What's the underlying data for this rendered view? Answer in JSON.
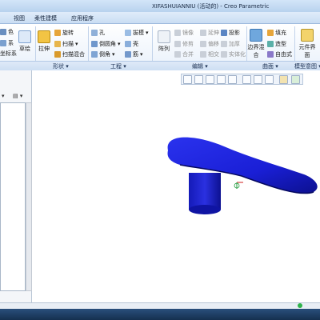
{
  "window": {
    "title": "XIFASHUIANNIU (活动的) - Creo Parametric"
  },
  "menu": {
    "tabs": [
      "视图",
      "柔性建模",
      "应用程序"
    ]
  },
  "ribbon": {
    "left_items": [
      "色",
      "系",
      "坐标系"
    ],
    "sketch_label": "草绘",
    "extrude_label": "拉伸",
    "shape": {
      "revolve": "旋转",
      "sweep": "扫描",
      "blend": "扫描混合"
    },
    "engineering": {
      "hole": "孔",
      "round": "倒圆角",
      "chamfer": "倒角",
      "draft": "拔模",
      "shell": "壳",
      "rib": "筋"
    },
    "pattern_label": "阵列",
    "editing": {
      "mirror": "镜像",
      "extend": "延伸",
      "project": "投影",
      "trim": "修剪",
      "offset": "偏移",
      "thicken": "加厚",
      "merge": "合并",
      "intersect": "相交",
      "solidify": "实体化"
    },
    "surface": {
      "boundary_blend": "边界混合",
      "fill": "填充",
      "style": "造型",
      "freestyle": "自由式"
    },
    "model_intent": "元件界面"
  },
  "groups": {
    "shape": "形状",
    "engineering": "工程",
    "editing": "编辑",
    "surface": "曲面",
    "model_intent": "模型意图"
  },
  "colors": {
    "model_blue": "#1a1fd6",
    "model_blue_dark": "#0a0d8a",
    "ribbon_border": "#9db9dd"
  },
  "graphics_toolbar": {
    "icons": [
      "refit-icon",
      "zoom-in-icon",
      "zoom-out-icon",
      "repaint-icon",
      "display-style-icon",
      "saved-orientations-icon",
      "view-manager-icon",
      "datum-display-icon",
      "annotation-display-icon",
      "spin-center-icon"
    ]
  }
}
